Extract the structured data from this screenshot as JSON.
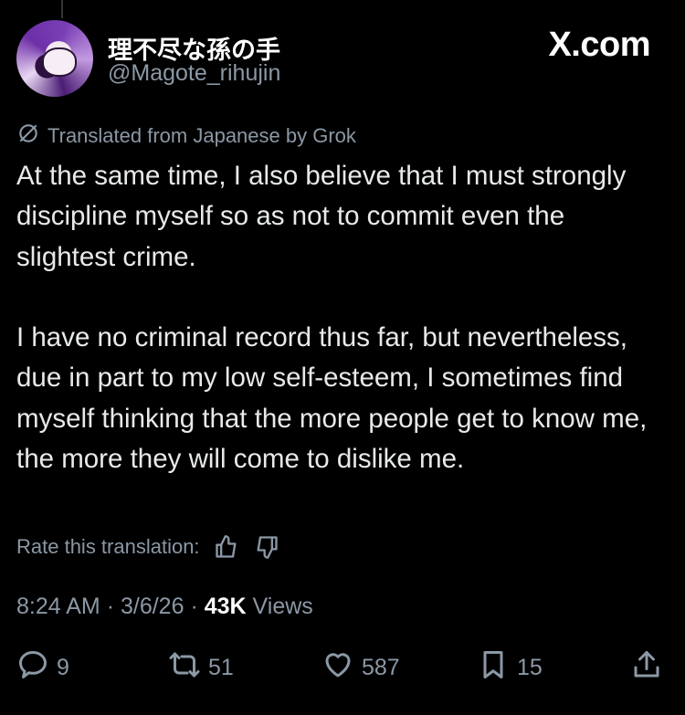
{
  "author": {
    "display_name": "理不尽な孫の手",
    "handle": "@Magote_rihujin"
  },
  "site_badge": "X.com",
  "translation_note": "Translated from Japanese by Grok",
  "post": {
    "body": "At the same time, I also believe that I must strongly discipline myself so as not to commit even the slightest crime.\n\nI have no criminal record thus far, but nevertheless, due in part to my low self-esteem, I sometimes find myself thinking that the more people get to know me, the more they will come to dislike me."
  },
  "rate_translation_label": "Rate this translation:",
  "meta": {
    "time": "8:24 AM",
    "separator": "·",
    "date": "3/6/26",
    "views_count": "43K",
    "views_label": "Views"
  },
  "actions": {
    "replies": "9",
    "reposts": "51",
    "likes": "587",
    "bookmarks": "15"
  },
  "icons": [
    "translate-icon",
    "thumbs-up-icon",
    "thumbs-down-icon",
    "reply-icon",
    "repost-icon",
    "like-icon",
    "bookmark-icon",
    "share-icon"
  ],
  "colors": {
    "background": "#000000",
    "text": "#e7e9ea",
    "secondary": "#8b98a5"
  }
}
